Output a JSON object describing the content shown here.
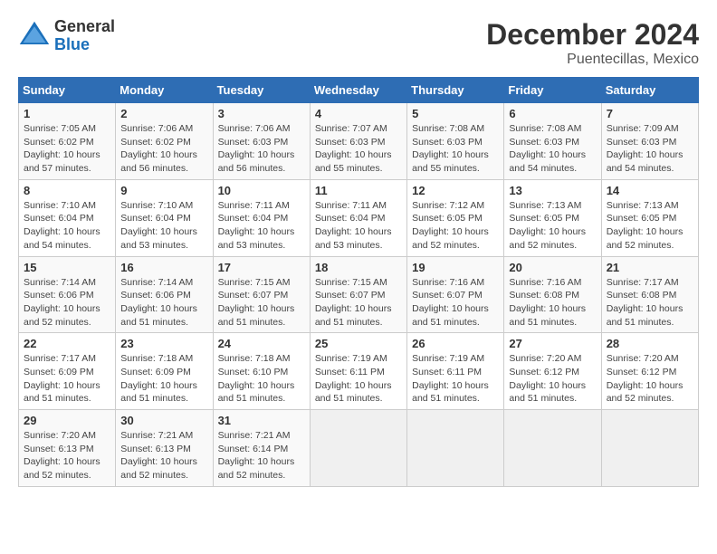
{
  "header": {
    "logo_general": "General",
    "logo_blue": "Blue",
    "title": "December 2024",
    "subtitle": "Puentecillas, Mexico"
  },
  "calendar": {
    "columns": [
      "Sunday",
      "Monday",
      "Tuesday",
      "Wednesday",
      "Thursday",
      "Friday",
      "Saturday"
    ],
    "weeks": [
      [
        {
          "day": "",
          "info": ""
        },
        {
          "day": "",
          "info": ""
        },
        {
          "day": "",
          "info": ""
        },
        {
          "day": "",
          "info": ""
        },
        {
          "day": "",
          "info": ""
        },
        {
          "day": "",
          "info": ""
        },
        {
          "day": "",
          "info": ""
        }
      ],
      [
        {
          "day": "1",
          "info": "Sunrise: 7:05 AM\nSunset: 6:02 PM\nDaylight: 10 hours\nand 57 minutes."
        },
        {
          "day": "2",
          "info": "Sunrise: 7:06 AM\nSunset: 6:02 PM\nDaylight: 10 hours\nand 56 minutes."
        },
        {
          "day": "3",
          "info": "Sunrise: 7:06 AM\nSunset: 6:03 PM\nDaylight: 10 hours\nand 56 minutes."
        },
        {
          "day": "4",
          "info": "Sunrise: 7:07 AM\nSunset: 6:03 PM\nDaylight: 10 hours\nand 55 minutes."
        },
        {
          "day": "5",
          "info": "Sunrise: 7:08 AM\nSunset: 6:03 PM\nDaylight: 10 hours\nand 55 minutes."
        },
        {
          "day": "6",
          "info": "Sunrise: 7:08 AM\nSunset: 6:03 PM\nDaylight: 10 hours\nand 54 minutes."
        },
        {
          "day": "7",
          "info": "Sunrise: 7:09 AM\nSunset: 6:03 PM\nDaylight: 10 hours\nand 54 minutes."
        }
      ],
      [
        {
          "day": "8",
          "info": "Sunrise: 7:10 AM\nSunset: 6:04 PM\nDaylight: 10 hours\nand 54 minutes."
        },
        {
          "day": "9",
          "info": "Sunrise: 7:10 AM\nSunset: 6:04 PM\nDaylight: 10 hours\nand 53 minutes."
        },
        {
          "day": "10",
          "info": "Sunrise: 7:11 AM\nSunset: 6:04 PM\nDaylight: 10 hours\nand 53 minutes."
        },
        {
          "day": "11",
          "info": "Sunrise: 7:11 AM\nSunset: 6:04 PM\nDaylight: 10 hours\nand 53 minutes."
        },
        {
          "day": "12",
          "info": "Sunrise: 7:12 AM\nSunset: 6:05 PM\nDaylight: 10 hours\nand 52 minutes."
        },
        {
          "day": "13",
          "info": "Sunrise: 7:13 AM\nSunset: 6:05 PM\nDaylight: 10 hours\nand 52 minutes."
        },
        {
          "day": "14",
          "info": "Sunrise: 7:13 AM\nSunset: 6:05 PM\nDaylight: 10 hours\nand 52 minutes."
        }
      ],
      [
        {
          "day": "15",
          "info": "Sunrise: 7:14 AM\nSunset: 6:06 PM\nDaylight: 10 hours\nand 52 minutes."
        },
        {
          "day": "16",
          "info": "Sunrise: 7:14 AM\nSunset: 6:06 PM\nDaylight: 10 hours\nand 51 minutes."
        },
        {
          "day": "17",
          "info": "Sunrise: 7:15 AM\nSunset: 6:07 PM\nDaylight: 10 hours\nand 51 minutes."
        },
        {
          "day": "18",
          "info": "Sunrise: 7:15 AM\nSunset: 6:07 PM\nDaylight: 10 hours\nand 51 minutes."
        },
        {
          "day": "19",
          "info": "Sunrise: 7:16 AM\nSunset: 6:07 PM\nDaylight: 10 hours\nand 51 minutes."
        },
        {
          "day": "20",
          "info": "Sunrise: 7:16 AM\nSunset: 6:08 PM\nDaylight: 10 hours\nand 51 minutes."
        },
        {
          "day": "21",
          "info": "Sunrise: 7:17 AM\nSunset: 6:08 PM\nDaylight: 10 hours\nand 51 minutes."
        }
      ],
      [
        {
          "day": "22",
          "info": "Sunrise: 7:17 AM\nSunset: 6:09 PM\nDaylight: 10 hours\nand 51 minutes."
        },
        {
          "day": "23",
          "info": "Sunrise: 7:18 AM\nSunset: 6:09 PM\nDaylight: 10 hours\nand 51 minutes."
        },
        {
          "day": "24",
          "info": "Sunrise: 7:18 AM\nSunset: 6:10 PM\nDaylight: 10 hours\nand 51 minutes."
        },
        {
          "day": "25",
          "info": "Sunrise: 7:19 AM\nSunset: 6:11 PM\nDaylight: 10 hours\nand 51 minutes."
        },
        {
          "day": "26",
          "info": "Sunrise: 7:19 AM\nSunset: 6:11 PM\nDaylight: 10 hours\nand 51 minutes."
        },
        {
          "day": "27",
          "info": "Sunrise: 7:20 AM\nSunset: 6:12 PM\nDaylight: 10 hours\nand 51 minutes."
        },
        {
          "day": "28",
          "info": "Sunrise: 7:20 AM\nSunset: 6:12 PM\nDaylight: 10 hours\nand 52 minutes."
        }
      ],
      [
        {
          "day": "29",
          "info": "Sunrise: 7:20 AM\nSunset: 6:13 PM\nDaylight: 10 hours\nand 52 minutes."
        },
        {
          "day": "30",
          "info": "Sunrise: 7:21 AM\nSunset: 6:13 PM\nDaylight: 10 hours\nand 52 minutes."
        },
        {
          "day": "31",
          "info": "Sunrise: 7:21 AM\nSunset: 6:14 PM\nDaylight: 10 hours\nand 52 minutes."
        },
        {
          "day": "",
          "info": ""
        },
        {
          "day": "",
          "info": ""
        },
        {
          "day": "",
          "info": ""
        },
        {
          "day": "",
          "info": ""
        }
      ]
    ]
  }
}
